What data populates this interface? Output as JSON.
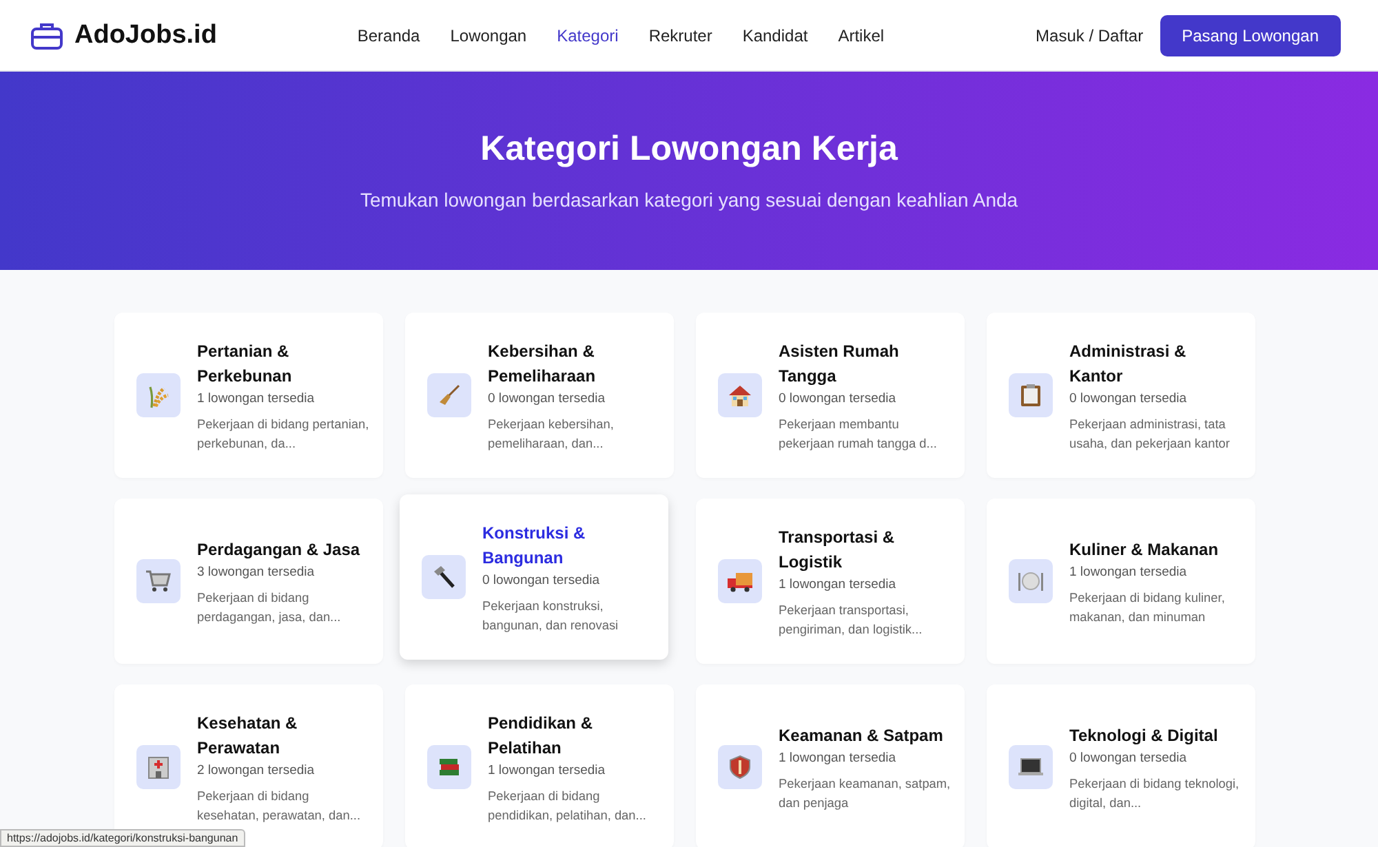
{
  "header": {
    "logo": "AdoJobs.id",
    "nav": [
      {
        "label": "Beranda",
        "selected": false
      },
      {
        "label": "Lowongan",
        "selected": false
      },
      {
        "label": "Kategori",
        "selected": true
      },
      {
        "label": "Rekruter",
        "selected": false
      },
      {
        "label": "Kandidat",
        "selected": false
      },
      {
        "label": "Artikel",
        "selected": false
      }
    ],
    "login": "Masuk / Daftar",
    "cta": "Pasang Lowongan"
  },
  "hero": {
    "title": "Kategori Lowongan Kerja",
    "subtitle": "Temukan lowongan berdasarkan kategori yang sesuai dengan keahlian Anda"
  },
  "categories": [
    {
      "title": "Pertanian & Perkebunan",
      "count": "1 lowongan tersedia",
      "description": "Pekerjaan di bidang pertanian, perkebunan, da...",
      "hovered": false
    },
    {
      "title": "Kebersihan & Pemeliharaan",
      "count": "0 lowongan tersedia",
      "description": "Pekerjaan kebersihan, pemeliharaan, dan...",
      "hovered": false
    },
    {
      "title": "Asisten Rumah Tangga",
      "count": "0 lowongan tersedia",
      "description": "Pekerjaan membantu pekerjaan rumah tangga d...",
      "hovered": false
    },
    {
      "title": "Administrasi & Kantor",
      "count": "0 lowongan tersedia",
      "description": "Pekerjaan administrasi, tata usaha, dan pekerjaan kantor",
      "hovered": false
    },
    {
      "title": "Perdagangan & Jasa",
      "count": "3 lowongan tersedia",
      "description": "Pekerjaan di bidang perdagangan, jasa, dan...",
      "hovered": false
    },
    {
      "title": "Konstruksi & Bangunan",
      "count": "0 lowongan tersedia",
      "description": "Pekerjaan konstruksi, bangunan, dan renovasi",
      "hovered": true
    },
    {
      "title": "Transportasi & Logistik",
      "count": "1 lowongan tersedia",
      "description": "Pekerjaan transportasi, pengiriman, dan logistik...",
      "hovered": false
    },
    {
      "title": "Kuliner & Makanan",
      "count": "1 lowongan tersedia",
      "description": "Pekerjaan di bidang kuliner, makanan, dan minuman",
      "hovered": false
    },
    {
      "title": "Kesehatan & Perawatan",
      "count": "2 lowongan tersedia",
      "description": "Pekerjaan di bidang kesehatan, perawatan, dan...",
      "hovered": false
    },
    {
      "title": "Pendidikan & Pelatihan",
      "count": "1 lowongan tersedia",
      "description": "Pekerjaan di bidang pendidikan, pelatihan, dan...",
      "hovered": false
    },
    {
      "title": "Keamanan & Satpam",
      "count": "1 lowongan tersedia",
      "description": "Pekerjaan keamanan, satpam, dan penjaga",
      "hovered": false
    },
    {
      "title": "Teknologi & Digital",
      "count": "0 lowongan tersedia",
      "description": "Pekerjaan di bidang teknologi, digital, dan...",
      "hovered": false
    }
  ],
  "status_url": "https://adojobs.id/kategori/konstruksi-bangunan"
}
